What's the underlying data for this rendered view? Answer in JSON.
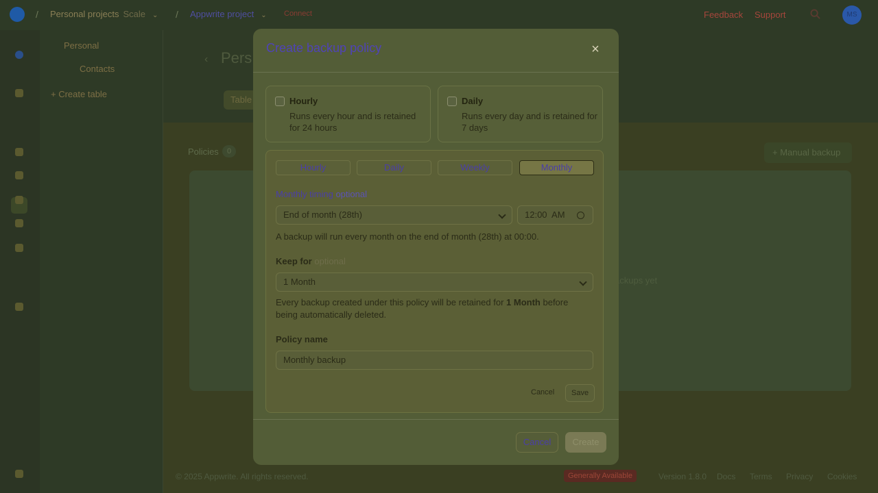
{
  "topbar": {
    "org": "Personal projects",
    "plan": "Scale",
    "project": "Appwrite project",
    "connect": "Connect",
    "feedback": "Feedback",
    "support": "Support",
    "avatar": "MS"
  },
  "sidebar": {
    "database": "Personal",
    "table": "Contacts",
    "create_table": "Create table"
  },
  "main": {
    "title": "Pers",
    "tab": "Table",
    "policies_label": "Policies",
    "policies_count": "0",
    "manual_backup": "Manual backup",
    "empty_text": "ackups yet"
  },
  "footer": {
    "copyright": "© 2025 Appwrite. All rights reserved.",
    "status": "Generally Available",
    "version": "Version 1.8.0",
    "links": [
      "Docs",
      "Terms",
      "Privacy",
      "Cookies"
    ]
  },
  "modal": {
    "title": "Create backup policy",
    "options": [
      {
        "title": "Hourly",
        "desc": "Runs every hour and is retained for 24 hours"
      },
      {
        "title": "Daily",
        "desc": "Runs every day and is retained for 7 days"
      }
    ],
    "segments": [
      "Hourly",
      "Daily",
      "Weekly",
      "Monthly"
    ],
    "active_segment": "Monthly",
    "timing_label": "Monthly timing",
    "optional": "optional",
    "timing_value": "End of month (28th)",
    "time_value": "12:00  AM",
    "timing_help": "A backup will run every month on the end of month (28th) at 00:00.",
    "keep_label": "Keep for",
    "keep_value": "1 Month",
    "keep_help_pre": "Every backup created under this policy will be retained for",
    "keep_help_bold": "1 Month",
    "keep_help_post": "before being automatically deleted.",
    "policy_name_label": "Policy name",
    "policy_name_value": "Monthly backup",
    "panel_cancel": "Cancel",
    "panel_save": "Save",
    "cancel": "Cancel",
    "create": "Create"
  }
}
